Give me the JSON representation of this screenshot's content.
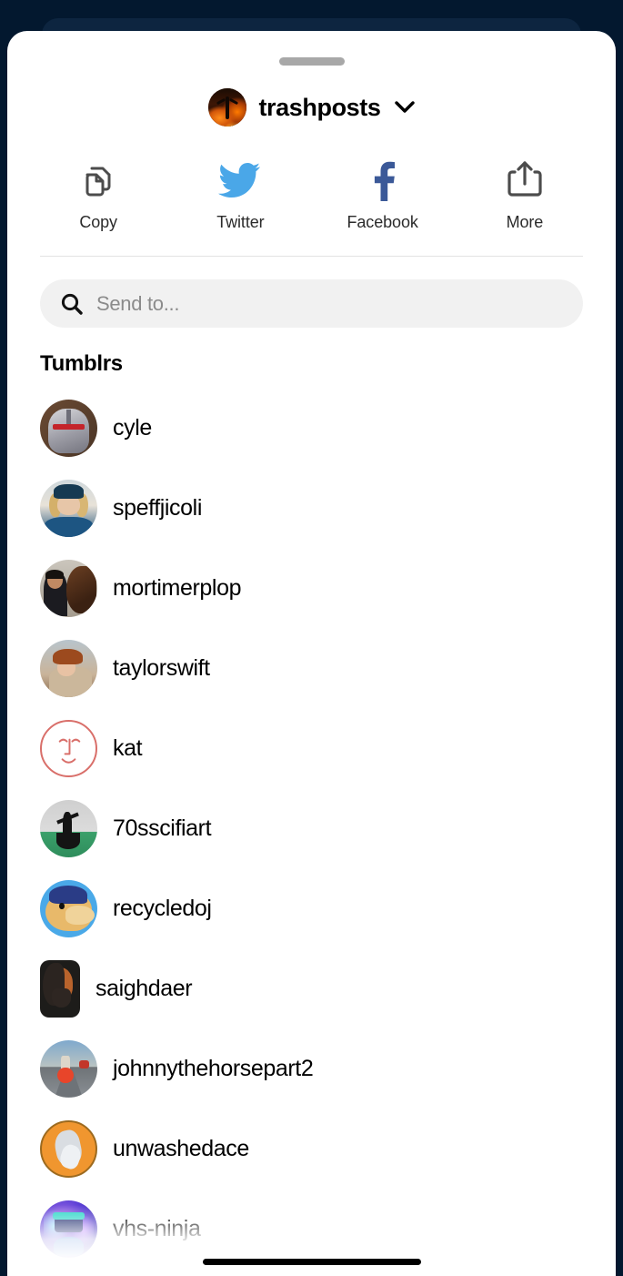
{
  "sheet": {
    "grabber": "drag-handle",
    "blog": {
      "name": "trashposts",
      "avatar_alt": "trashposts-avatar",
      "chevron": "chevron-down-icon"
    },
    "actions": [
      {
        "id": "copy",
        "label": "Copy",
        "icon": "copy-icon",
        "color": "#4c4c4c"
      },
      {
        "id": "twitter",
        "label": "Twitter",
        "icon": "twitter-icon",
        "color": "#4aa7e8"
      },
      {
        "id": "facebook",
        "label": "Facebook",
        "icon": "facebook-icon",
        "color": "#3b5998"
      },
      {
        "id": "more",
        "label": "More",
        "icon": "share-icon",
        "color": "#4c4c4c"
      }
    ],
    "search": {
      "placeholder": "Send to...",
      "value": "",
      "icon": "search-icon"
    },
    "section_title": "Tumblrs",
    "blogs": [
      {
        "name": "cyle",
        "avatar": "av-cyle"
      },
      {
        "name": "speffjicoli",
        "avatar": "av-speff"
      },
      {
        "name": "mortimerplop",
        "avatar": "av-mort"
      },
      {
        "name": "taylorswift",
        "avatar": "av-taylor"
      },
      {
        "name": "kat",
        "avatar": "av-kat"
      },
      {
        "name": "70sscifiart",
        "avatar": "av-70s"
      },
      {
        "name": "recycledoj",
        "avatar": "av-recycle"
      },
      {
        "name": "saighdaer",
        "avatar": "av-saigh"
      },
      {
        "name": "johnnythehorsepart2",
        "avatar": "av-johnny"
      },
      {
        "name": "unwashedace",
        "avatar": "av-unwashed"
      },
      {
        "name": "vhs-ninja",
        "avatar": "av-vhs"
      }
    ],
    "home_indicator": "home-indicator"
  },
  "colors": {
    "backdrop": "#001935",
    "sheet_bg": "#ffffff",
    "search_bg": "#f1f1f1",
    "divider": "#e3e3e3",
    "twitter_blue": "#4aa7e8",
    "facebook_blue": "#3b5998",
    "kat_outline": "#d96f6a"
  }
}
